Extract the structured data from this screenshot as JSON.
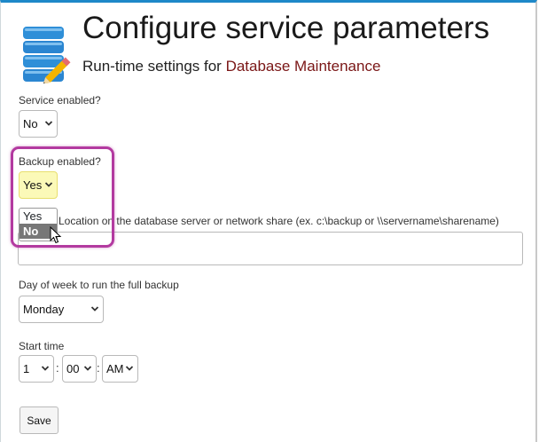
{
  "header": {
    "title": "Configure service parameters",
    "subtitle_prefix": "Run-time settings for ",
    "service_name": "Database Maintenance"
  },
  "form": {
    "service_enabled": {
      "label": "Service enabled?",
      "value": "No"
    },
    "backup_enabled": {
      "label": "Backup enabled?",
      "value": "Yes",
      "options": [
        "Yes",
        "No"
      ],
      "hovered_option": "No"
    },
    "backup_location": {
      "label": "Location on the database server or network share (ex. c:\\backup or \\\\servername\\sharename)",
      "value": ""
    },
    "backup_day": {
      "label": "Day of week to run the full backup",
      "value": "Monday"
    },
    "start_time": {
      "label": "Start time",
      "hour": "1",
      "separator": ":",
      "minute": "00",
      "ampm": "AM"
    },
    "save_label": "Save"
  },
  "colors": {
    "accent_border": "#1e88c8",
    "service_name": "#7a1616",
    "annotation_highlight": "#b33aa0",
    "selected_select_bg": "#fbf9b8"
  },
  "icons": [
    "database-edit-icon",
    "chevron-down-icon",
    "mouse-pointer-icon"
  ]
}
